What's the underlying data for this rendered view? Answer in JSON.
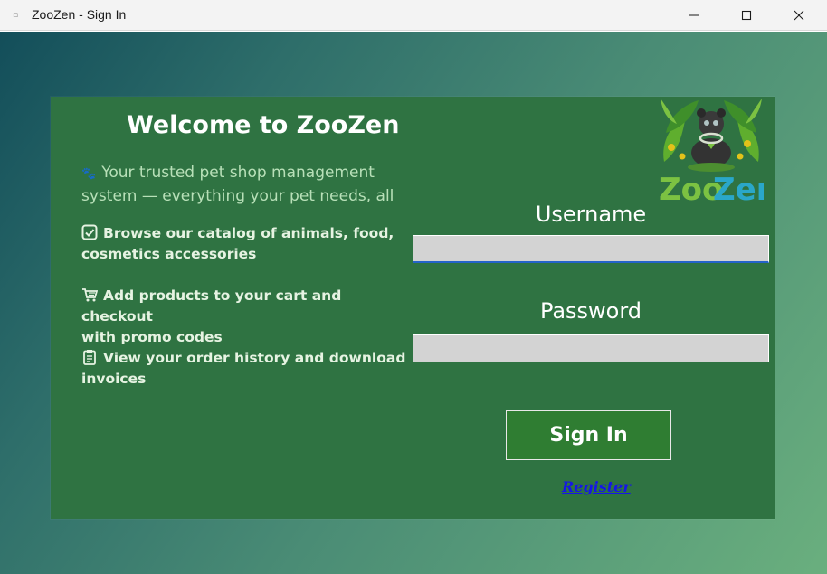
{
  "window": {
    "title": "ZooZen - Sign In"
  },
  "welcome": {
    "title": "Welcome to ZooZen",
    "tagline_line1": "Your trusted pet shop management",
    "tagline_line2": "system — everything your pet needs, all",
    "features": [
      {
        "icon": "checkbox-icon",
        "line1": "Browse our catalog of animals, food,",
        "line2": "cosmetics  accessories"
      },
      {
        "icon": "cart-icon",
        "line1": "Add products to your cart and checkout",
        "line2": "with promo codes"
      },
      {
        "icon": "clipboard-icon",
        "line1": "View your order history and download",
        "line2": "invoices"
      }
    ]
  },
  "logo": {
    "text_zoo": "Zoo",
    "text_zen": "Zen",
    "colors": {
      "zoo": "#7cc242",
      "zen": "#2aa7c9"
    }
  },
  "form": {
    "username_label": "Username",
    "username_value": "",
    "password_label": "Password",
    "password_value": "",
    "signin_label": "Sign In",
    "register_label": "Register"
  },
  "colors": {
    "card": "#2f7342",
    "button": "#2f7d32",
    "link": "#1616e6",
    "input_bg": "#d3d3d3"
  }
}
